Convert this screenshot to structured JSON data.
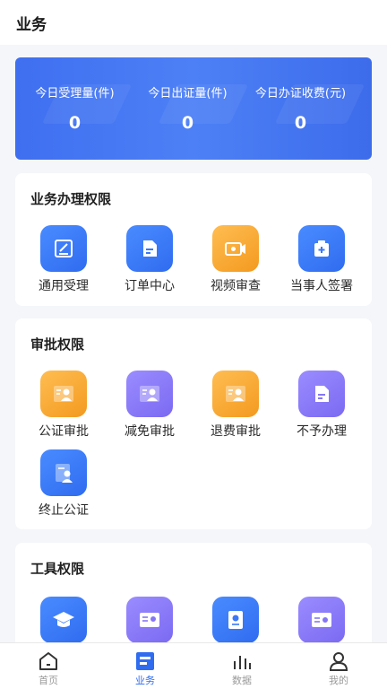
{
  "header": {
    "title": "业务"
  },
  "stats": [
    {
      "label": "今日受理量(件)",
      "value": "0"
    },
    {
      "label": "今日出证量(件)",
      "value": "0"
    },
    {
      "label": "今日办证收费(元)",
      "value": "0"
    }
  ],
  "business": {
    "title": "业务办理权限",
    "items": [
      {
        "label": "通用受理",
        "icon": "edit-form-icon"
      },
      {
        "label": "订单中心",
        "icon": "document-icon"
      },
      {
        "label": "视频审查",
        "icon": "video-camera-icon"
      },
      {
        "label": "当事人签署",
        "icon": "medical-kit-icon"
      }
    ]
  },
  "approval": {
    "title": "审批权限",
    "items": [
      {
        "label": "公证审批",
        "icon": "id-card-icon"
      },
      {
        "label": "减免审批",
        "icon": "id-card-icon"
      },
      {
        "label": "退费审批",
        "icon": "id-card-icon"
      },
      {
        "label": "不予办理",
        "icon": "document-icon"
      },
      {
        "label": "终止公证",
        "icon": "user-document-icon"
      }
    ]
  },
  "tools": {
    "title": "工具权限",
    "items": [
      {
        "icon": "graduation-cap-icon"
      },
      {
        "icon": "id-card-icon"
      },
      {
        "icon": "certificate-icon"
      },
      {
        "icon": "id-card-icon"
      }
    ]
  },
  "tabbar": {
    "items": [
      {
        "label": "首页",
        "icon": "home-icon"
      },
      {
        "label": "业务",
        "icon": "briefcase-icon",
        "active": true
      },
      {
        "label": "数据",
        "icon": "bar-chart-icon"
      },
      {
        "label": "我的",
        "icon": "user-icon"
      }
    ]
  },
  "colors": {
    "primary": "#2f6cf0",
    "orange": "#f39a1f",
    "purple": "#7b6af2"
  }
}
